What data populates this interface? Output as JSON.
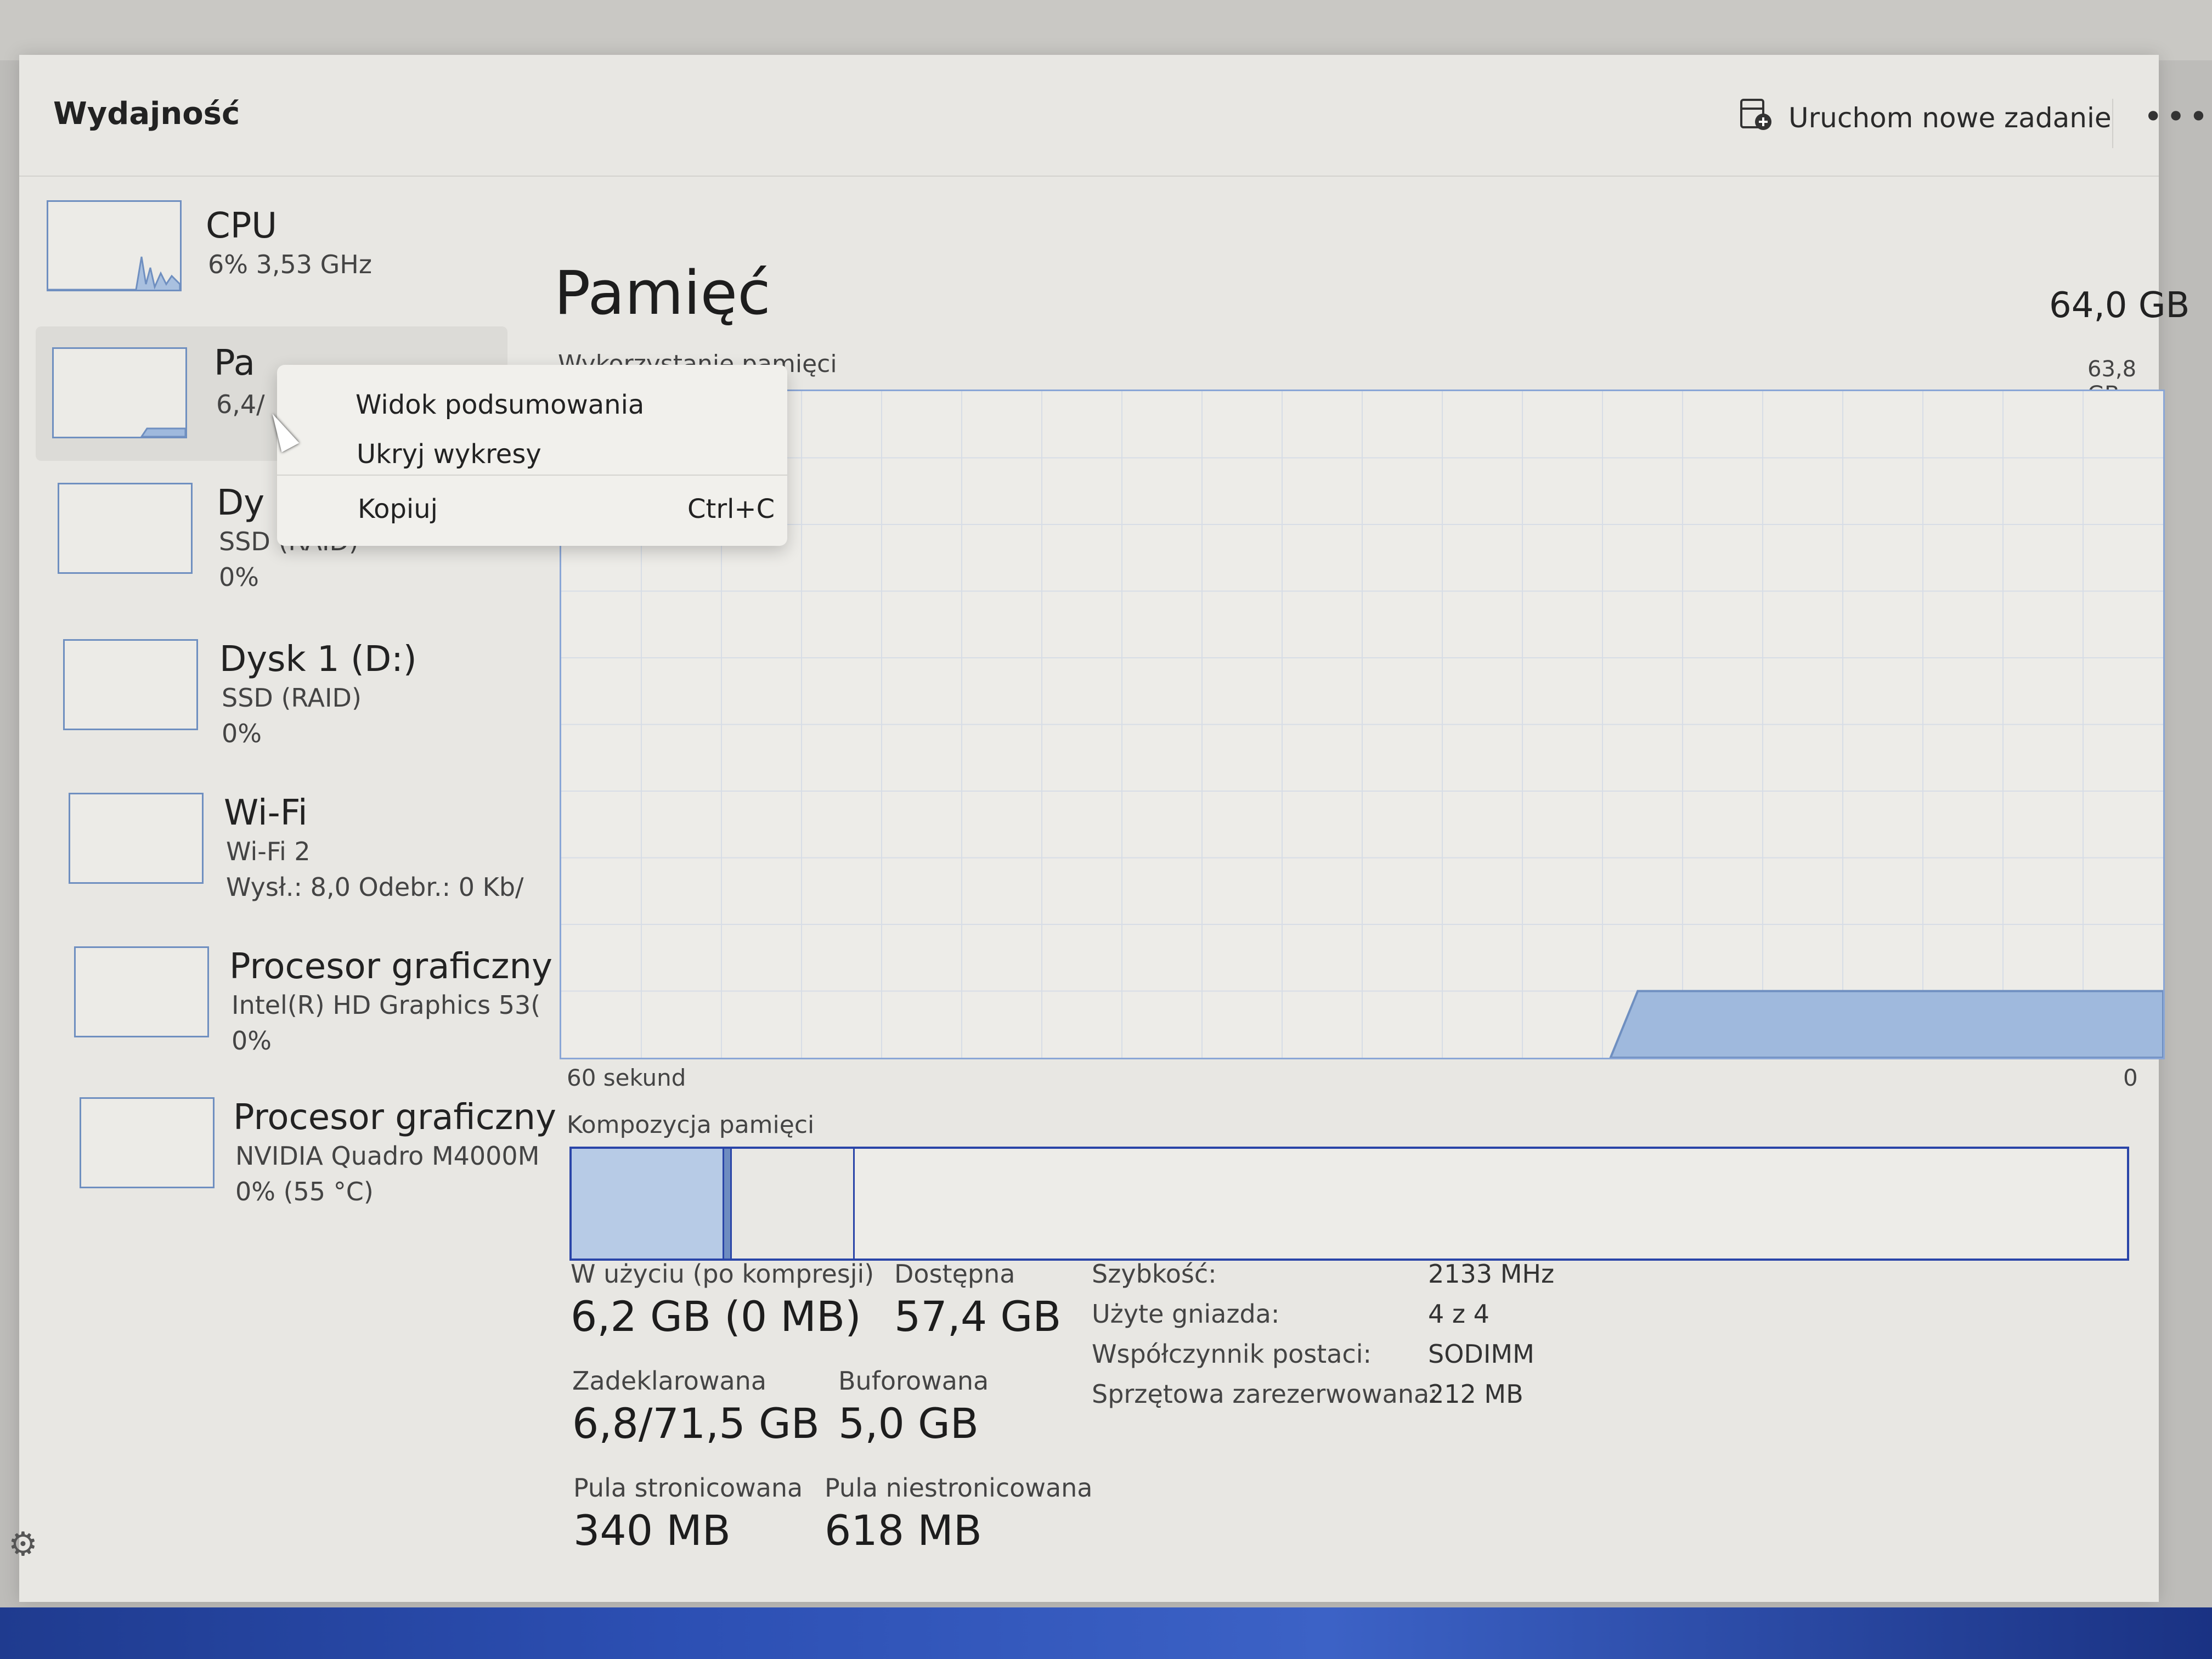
{
  "header": {
    "title": "Wydajność",
    "run_task_label": "Uruchom nowe zadanie",
    "more_label": "•••"
  },
  "sidebar": {
    "items": [
      {
        "name": "CPU",
        "sub1": "6% 3,53 GHz",
        "sub2": ""
      },
      {
        "name": "Pa",
        "sub1": "6,4/",
        "sub2": ""
      },
      {
        "name": "Dy",
        "sub1": "SSD (RAID)",
        "sub2": "0%"
      },
      {
        "name": "Dysk 1 (D:)",
        "sub1": "SSD (RAID)",
        "sub2": "0%"
      },
      {
        "name": "Wi-Fi",
        "sub1": "Wi-Fi 2",
        "sub2": "Wysł.: 8,0 Odebr.: 0 Kb/"
      },
      {
        "name": "Procesor graficzny",
        "sub1": "Intel(R) HD Graphics 53(",
        "sub2": "0%"
      },
      {
        "name": "Procesor graficzny",
        "sub1": "NVIDIA Quadro M4000M",
        "sub2": "0% (55 °C)"
      }
    ]
  },
  "context_menu": {
    "items": [
      {
        "label": "Widok podsumowania",
        "shortcut": ""
      },
      {
        "label": "Ukryj wykresy",
        "shortcut": ""
      },
      {
        "label": "Kopiuj",
        "shortcut": "Ctrl+C"
      }
    ]
  },
  "main": {
    "title": "Pamięć",
    "total": "64,0 GB",
    "usage_label": "Wykorzystanie pamięci",
    "usage_max": "63,8 GB",
    "x_left": "60 sekund",
    "x_right": "0",
    "composition_label": "Kompozycja pamięci",
    "composition": {
      "in_use_fraction": 0.097,
      "modified_fraction": 0.004,
      "standby_fraction": 0.078,
      "colors": {
        "in_use": "#b7cbe6",
        "modified": "#6e8cc0",
        "standby": "#e9e8e4",
        "free": "#edece8",
        "border": "#2a45a8"
      }
    },
    "usage_level_fraction": 0.1
  },
  "stats": {
    "in_use_label": "W użyciu (po kompresji)",
    "in_use_value": "6,2 GB (0 MB)",
    "available_label": "Dostępna",
    "available_value": "57,4 GB",
    "committed_label": "Zadeklarowana",
    "committed_value": "6,8/71,5 GB",
    "cached_label": "Buforowana",
    "cached_value": "5,0 GB",
    "paged_label": "Pula stronicowana",
    "paged_value": "340 MB",
    "nonpaged_label": "Pula niestronicowana",
    "nonpaged_value": "618 MB"
  },
  "details": [
    {
      "key": "Szybkość:",
      "value": "2133 MHz"
    },
    {
      "key": "Użyte gniazda:",
      "value": "4 z 4"
    },
    {
      "key": "Współczynnik postaci:",
      "value": "SODIMM"
    },
    {
      "key": "Sprzętowa zarezerwowana:",
      "value": "212 MB"
    }
  ],
  "colors": {
    "accent_blue": "#2a45a8",
    "graph_fill": "#9fb9dd",
    "graph_line": "#6f8fc0"
  }
}
